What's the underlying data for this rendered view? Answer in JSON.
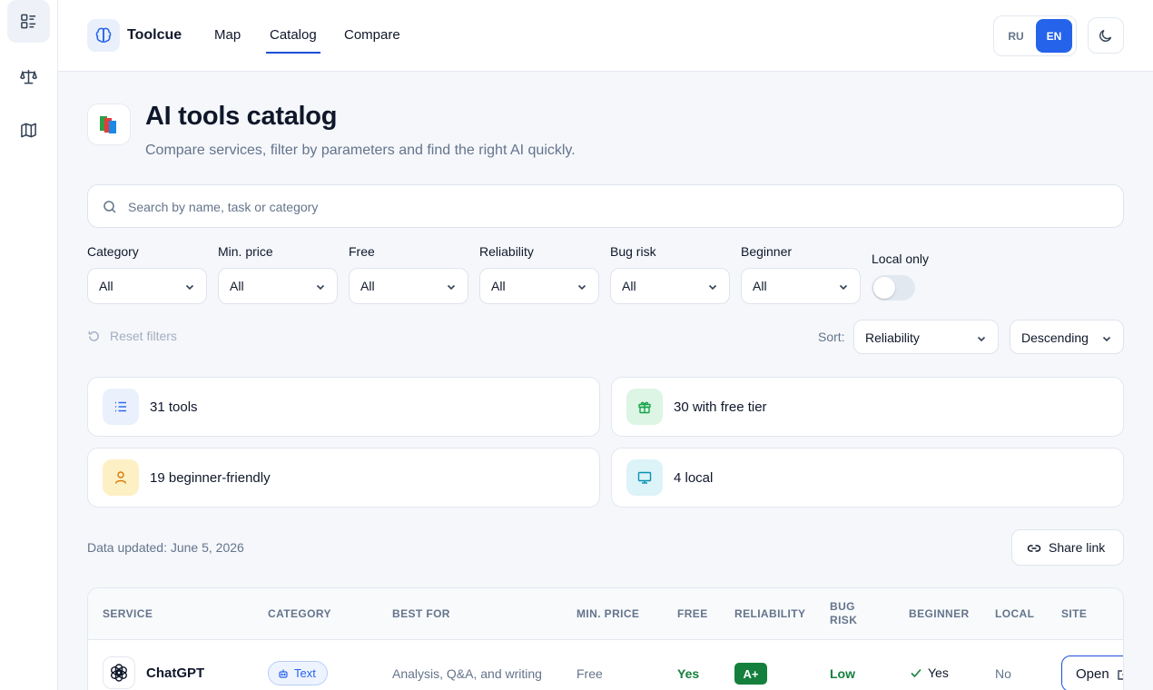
{
  "app": {
    "brand": "Toolcue"
  },
  "nav": {
    "links": [
      "Map",
      "Catalog",
      "Compare"
    ],
    "active": "Catalog"
  },
  "lang": {
    "ru": "RU",
    "en": "EN",
    "active": "EN"
  },
  "sidebar": {
    "items": [
      {
        "icon": "catalog-list-icon",
        "active": true
      },
      {
        "icon": "scale-compare-icon",
        "active": false
      },
      {
        "icon": "map-icon",
        "active": false
      }
    ]
  },
  "header": {
    "title": "AI tools catalog",
    "subtitle": "Compare services, filter by parameters and find the right AI quickly."
  },
  "search": {
    "placeholder": "Search by name, task or category",
    "value": ""
  },
  "filters": [
    {
      "label": "Category",
      "value": "All"
    },
    {
      "label": "Min. price",
      "value": "All"
    },
    {
      "label": "Free",
      "value": "All"
    },
    {
      "label": "Reliability",
      "value": "All"
    },
    {
      "label": "Bug risk",
      "value": "All"
    },
    {
      "label": "Beginner",
      "value": "All"
    }
  ],
  "local_only": {
    "label": "Local only",
    "on": false
  },
  "reset_label": "Reset filters",
  "sort": {
    "label": "Sort:",
    "field": "Reliability",
    "order": "Descending"
  },
  "stats": [
    {
      "text": "31 tools",
      "icon": "list-icon",
      "color": "#2563eb"
    },
    {
      "text": "30 with free tier",
      "icon": "gift-icon",
      "color": "#16a34a"
    },
    {
      "text": "19 beginner-friendly",
      "icon": "user-icon",
      "color": "#d97706"
    },
    {
      "text": "4 local",
      "icon": "monitor-icon",
      "color": "#0891b2"
    }
  ],
  "updated": "Data updated: June 5, 2026",
  "share_label": "Share link",
  "table": {
    "headers": [
      "Service",
      "Category",
      "Best for",
      "Min. price",
      "Free",
      "Reliability",
      "Bug risk",
      "Beginner",
      "Local",
      "Site"
    ],
    "rows": [
      {
        "service": "ChatGPT",
        "category": "Text",
        "best_for": "Analysis, Q&A, and writing",
        "min_price": "Free",
        "free": "Yes",
        "reliability": "A+",
        "bug_risk": "Low",
        "beginner": "Yes",
        "local": "No",
        "site": "Open"
      }
    ]
  }
}
